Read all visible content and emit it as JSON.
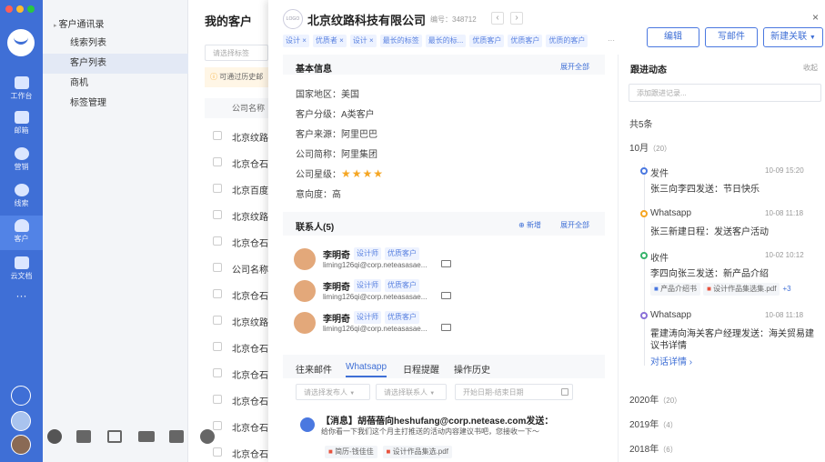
{
  "rail": {
    "items": [
      {
        "label": "工作台",
        "icon": "dashboard-icon"
      },
      {
        "label": "邮箱",
        "icon": "mail-icon"
      },
      {
        "label": "营销",
        "icon": "pie-chart-icon"
      },
      {
        "label": "线索",
        "icon": "lead-icon"
      },
      {
        "label": "客户",
        "icon": "customer-icon"
      },
      {
        "label": "云文档",
        "icon": "cloud-doc-icon"
      }
    ],
    "more": "···"
  },
  "menu": {
    "group": "客户通讯录",
    "items": [
      "线索列表",
      "客户列表",
      "商机",
      "标签管理"
    ],
    "active": "客户列表"
  },
  "list": {
    "title": "我的客户",
    "filter_placeholder": "请选择标签",
    "notice": "可通过历史邮",
    "column": "公司名称",
    "rows": [
      "北京纹路",
      "北京仓石",
      "北京百度",
      "北京纹路",
      "北京仓石",
      "公司名称",
      "北京仓石",
      "北京纹路",
      "北京仓石",
      "北京仓石",
      "北京仓石",
      "北京仓石",
      "北京仓石"
    ]
  },
  "detail": {
    "logo": "LOGO",
    "company": "北京纹路科技有限公司",
    "code_label": "编号：",
    "code": "348712",
    "tags": [
      "设计 ×",
      "优质者 ×",
      "设计 ×",
      "最长的标签",
      "最长的标...",
      "优质客户",
      "优质客户",
      "优质的客户"
    ],
    "tags_more": "···",
    "buttons": {
      "edit": "编辑",
      "mail": "写邮件",
      "new": "新建关联"
    },
    "basic": {
      "title": "基本信息",
      "expand": "展开全部",
      "fields": [
        {
          "k": "国家地区：",
          "v": "美国"
        },
        {
          "k": "客户分级：",
          "v": "A类客户"
        },
        {
          "k": "客户来源：",
          "v": "阿里巴巴"
        },
        {
          "k": "公司简称：",
          "v": "阿里集团"
        },
        {
          "k": "公司星级：",
          "v": "★★★★"
        },
        {
          "k": "意向度：",
          "v": "高"
        }
      ]
    },
    "contacts": {
      "title": "联系人(5)",
      "add": "新增",
      "expand": "展开全部",
      "items": [
        {
          "name": "李明奇",
          "tags": [
            "设计师",
            "优质客户"
          ],
          "email": "liming126qi@corp.neteasasae..."
        },
        {
          "name": "李明奇",
          "tags": [
            "设计师",
            "优质客户"
          ],
          "email": "liming126qi@corp.neteasasae..."
        },
        {
          "name": "李明奇",
          "tags": [
            "设计师",
            "优质客户"
          ],
          "email": "liming126qi@corp.neteasasae..."
        }
      ]
    },
    "tabs": [
      "往来邮件",
      "Whatsapp",
      "日程提醒",
      "操作历史"
    ],
    "tab_active": "Whatsapp",
    "filters": {
      "sender": "请选择发布人",
      "contact": "请选择联系人",
      "date": "开始日期-结束日期"
    },
    "message": {
      "title": "【消息】胡蓓蓓向heshufang@corp.netease.com发送：",
      "body": "给你看一下我们这个月主打推送的活动内容建议书吧，您接收一下～",
      "files": [
        "简历-钱佳佳",
        "设计作品集选.pdf"
      ]
    }
  },
  "follow": {
    "title": "跟进动态",
    "collapse": "收起",
    "input_placeholder": "添加跟进记录...",
    "total": "共5条",
    "month": "10月",
    "month_count": "（20）",
    "events": [
      {
        "type": "发件",
        "time": "10-09 15:20",
        "text": "张三向李四发送：节日快乐"
      },
      {
        "type": "Whatsapp",
        "time": "10-08 11:18",
        "text": "张三新建日程：发送客户活动"
      },
      {
        "type": "收件",
        "time": "10-02 10:12",
        "text": "李四向张三发送：新产品介绍",
        "files": [
          "产品介绍书",
          "设计作品集选集.pdf"
        ],
        "more": "+3"
      },
      {
        "type": "Whatsapp",
        "time": "10-08 11:18",
        "text": "霍建涛向海关客户经理发送：海关贸易建议书详情",
        "link": "对话详情 ›"
      }
    ],
    "years": [
      {
        "y": "2020年",
        "c": "（20）"
      },
      {
        "y": "2019年",
        "c": "（4）"
      },
      {
        "y": "2018年",
        "c": "（6）"
      }
    ]
  }
}
